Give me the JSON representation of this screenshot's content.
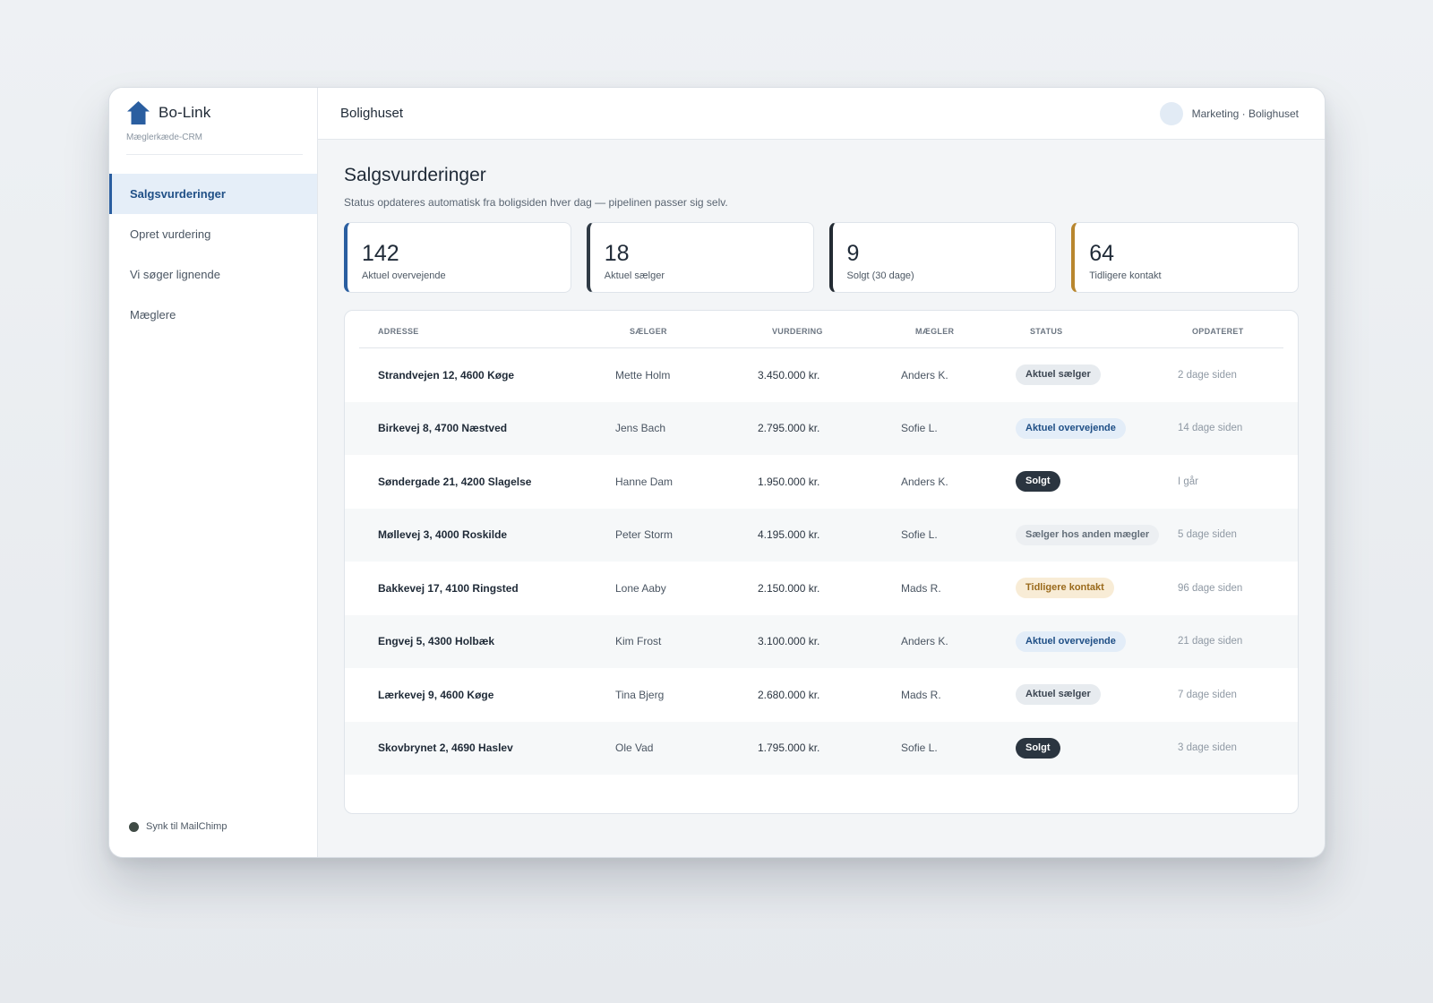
{
  "brand": {
    "name": "Bo-Link",
    "subtitle": "Mæglerkæde-CRM"
  },
  "sidebar": {
    "items": [
      {
        "label": "Salgsvurderinger",
        "active": true
      },
      {
        "label": "Opret vurdering"
      },
      {
        "label": "Vi søger lignende"
      },
      {
        "label": "Mæglere"
      }
    ],
    "sync_label": "Synk til MailChimp"
  },
  "topbar": {
    "title": "Bolighuset",
    "user": "Marketing · Bolighuset"
  },
  "page": {
    "title": "Salgsvurderinger",
    "subtitle": "Status opdateres automatisk fra boligsiden hver dag — pipelinen passer sig selv."
  },
  "stats": [
    {
      "value": "142",
      "label": "Aktuel overvejende",
      "accent": "#2a5ea0"
    },
    {
      "value": "18",
      "label": "Aktuel sælger",
      "accent": "#2f3a45"
    },
    {
      "value": "9",
      "label": "Solgt (30 dage)",
      "accent": "#232b33"
    },
    {
      "value": "64",
      "label": "Tidligere kontakt",
      "accent": "#b8862e"
    }
  ],
  "table": {
    "headers": {
      "address": "ADRESSE",
      "seller": "SÆLGER",
      "valuation": "VURDERING",
      "broker": "MÆGLER",
      "status": "STATUS",
      "updated": "OPDATERET"
    },
    "rows": [
      {
        "address": "Strandvejen 12, 4600 Køge",
        "seller": "Mette Holm",
        "valuation": "3.450.000 kr.",
        "broker": "Anders K.",
        "status": "Aktuel sælger",
        "updated": "2 dage siden"
      },
      {
        "address": "Birkevej 8, 4700 Næstved",
        "seller": "Jens Bach",
        "valuation": "2.795.000 kr.",
        "broker": "Sofie L.",
        "status": "Aktuel overvejende",
        "updated": "14 dage siden"
      },
      {
        "address": "Søndergade 21, 4200 Slagelse",
        "seller": "Hanne Dam",
        "valuation": "1.950.000 kr.",
        "broker": "Anders K.",
        "status": "Solgt",
        "updated": "I går"
      },
      {
        "address": "Møllevej 3, 4000 Roskilde",
        "seller": "Peter Storm",
        "valuation": "4.195.000 kr.",
        "broker": "Sofie L.",
        "status": "Sælger hos anden mægler",
        "updated": "5 dage siden"
      },
      {
        "address": "Bakkevej 17, 4100 Ringsted",
        "seller": "Lone Aaby",
        "valuation": "2.150.000 kr.",
        "broker": "Mads R.",
        "status": "Tidligere kontakt",
        "updated": "96 dage siden"
      },
      {
        "address": "Engvej 5, 4300 Holbæk",
        "seller": "Kim Frost",
        "valuation": "3.100.000 kr.",
        "broker": "Anders K.",
        "status": "Aktuel overvejende",
        "updated": "21 dage siden"
      },
      {
        "address": "Lærkevej 9, 4600 Køge",
        "seller": "Tina Bjerg",
        "valuation": "2.680.000 kr.",
        "broker": "Mads R.",
        "status": "Aktuel sælger",
        "updated": "7 dage siden"
      },
      {
        "address": "Skovbrynet 2, 4690 Haslev",
        "seller": "Ole Vad",
        "valuation": "1.795.000 kr.",
        "broker": "Sofie L.",
        "status": "Solgt",
        "updated": "3 dage siden"
      }
    ]
  }
}
